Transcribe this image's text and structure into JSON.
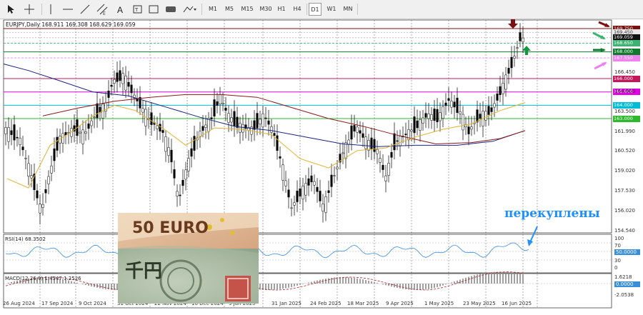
{
  "toolbar": {
    "timeframes": [
      "M1",
      "M5",
      "M15",
      "M30",
      "H1",
      "H4",
      "D1",
      "W1",
      "MN"
    ],
    "active_timeframe": "D1",
    "icons": [
      "cursor-icon",
      "crosshair-icon",
      "vertical-line-icon",
      "horizontal-line-icon",
      "trendline-icon",
      "channel-icon",
      "text-icon",
      "label-icon",
      "rectangle-icon",
      "shapes-menu-icon"
    ]
  },
  "header": {
    "symbol_line": "EURJPY,Daily  168.911 169.308 168.629 169.059"
  },
  "price_axis": {
    "ticks": [
      "166.450",
      "164.960",
      "163.500",
      "161.990",
      "160.520",
      "159.020",
      "157.530",
      "156.020",
      "154.540"
    ]
  },
  "levels": [
    {
      "price": "169.750",
      "color": "#7a1010",
      "text_color": "#ffffff"
    },
    {
      "price": "169.450",
      "color": "#e8e8e8",
      "text_color": "#333333"
    },
    {
      "price": "169.059",
      "color": "#111111",
      "text_color": "#ffffff"
    },
    {
      "price": "168.650",
      "color": "#3cb371",
      "text_color": "#ffffff"
    },
    {
      "price": "168.000",
      "color": "#0e7a2c",
      "text_color": "#ffffff"
    },
    {
      "price": "167.550",
      "color": "#ee82ee",
      "text_color": "#ffffff"
    },
    {
      "price": "166.000",
      "color": "#c2185b",
      "text_color": "#ffffff"
    },
    {
      "price": "165.000",
      "color": "#e000e0",
      "text_color": "#ffffff"
    },
    {
      "price": "164.000",
      "color": "#00bcd4",
      "text_color": "#ffffff"
    },
    {
      "price": "163.000",
      "color": "#2eb82e",
      "text_color": "#ffffff"
    }
  ],
  "annotation": {
    "text": "перекуплены",
    "color": "#1e90ff"
  },
  "rsi": {
    "label": "RSI(14) 68.3502",
    "levels": [
      "100",
      "70",
      "50.0000",
      "30",
      "0"
    ]
  },
  "macd": {
    "label": "MACD(12,26,9) 1.4547 1.2526",
    "levels": [
      "1.6218",
      "0.0000",
      "-2.0538"
    ]
  },
  "dates": [
    "26 Aug 2024",
    "17 Sep 2024",
    "9 Oct 2024",
    "31 Oct 2024",
    "22 Nov 2024",
    "16 Dec 2024",
    "9 Jan 2025",
    "31 Jan 2025",
    "24 Feb 2025",
    "18 Mar 2025",
    "9 Apr 2025",
    "1 May 2025",
    "23 May 2025",
    "16 Jun 2025"
  ],
  "photo": {
    "banknote_eur": "50 EURO",
    "banknote_jpy": "千円"
  },
  "colors": {
    "ma_slow": "#1a237e",
    "ma_mid": "#8b1a1a",
    "ma_fast": "#e0b030",
    "rsi": "#3a8ed8",
    "macd": "#b22222"
  }
}
